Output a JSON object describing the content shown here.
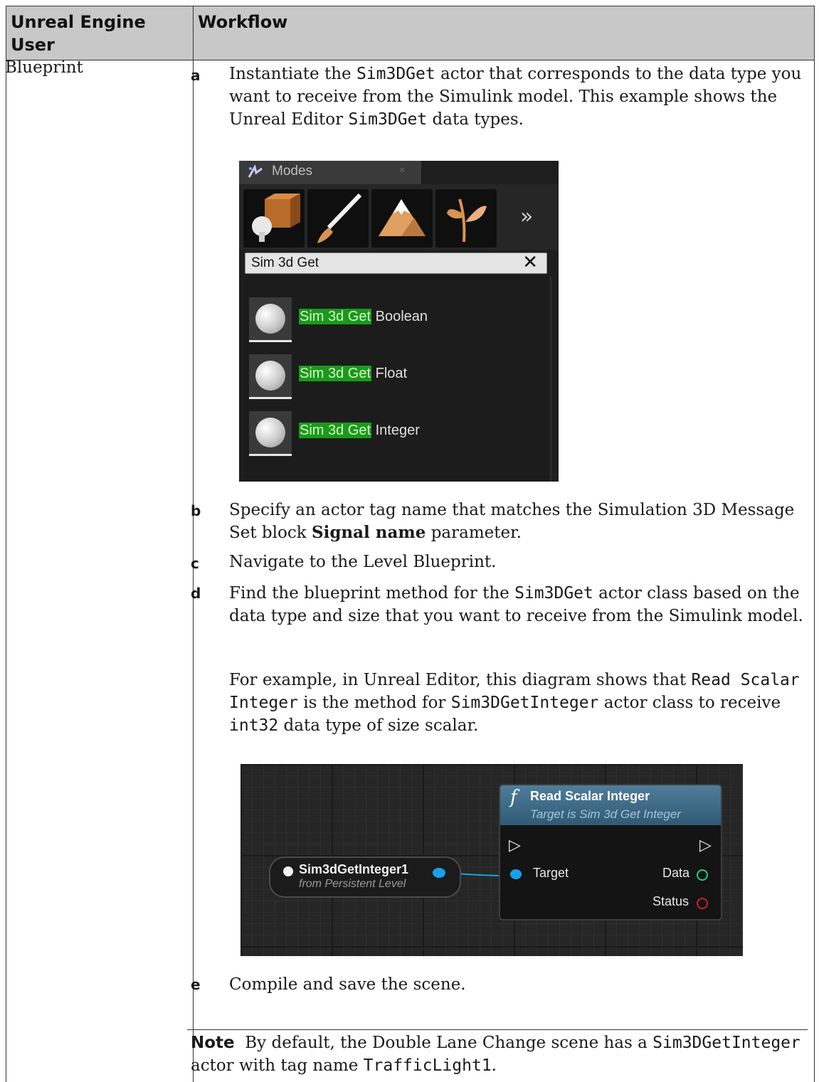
{
  "table": {
    "header": {
      "col1": "Unreal Engine User",
      "col2": "Workflow"
    },
    "row": {
      "user": "Blueprint",
      "steps": [
        {
          "letter": "a",
          "text_parts": [
            "Instantiate the ",
            "Sim3DGet",
            " actor that corresponds to the data type you want to receive from the Simulink model. This example shows the Unreal Editor ",
            "Sim3DGet",
            " data types."
          ]
        },
        {
          "letter": "b",
          "text_parts": [
            "Specify an actor tag name that matches the Simulation 3D Message Set block ",
            "Signal name",
            " parameter."
          ]
        },
        {
          "letter": "c",
          "text": "Navigate to the Level Blueprint."
        },
        {
          "letter": "d",
          "text_parts": [
            "Find the blueprint method for the ",
            "Sim3DGet",
            " actor class based on the data type and size that you want to receive from the Simulink model."
          ],
          "example_parts": [
            "For example, in Unreal Editor, this diagram shows that ",
            "Read Scalar Integer",
            " is the method for ",
            "Sim3DGetInteger",
            " actor class to receive ",
            "int32",
            " data type of size scalar."
          ]
        },
        {
          "letter": "e",
          "text": "Compile and save the scene."
        }
      ],
      "note": {
        "label": "Note",
        "parts": [
          "By default, the Double Lane Change scene has a ",
          "Sim3DGetInteger",
          " actor with tag name ",
          "TrafficLight1",
          "."
        ]
      }
    }
  },
  "modes_panel": {
    "tab_title": "Modes",
    "tab_close": "×",
    "more_glyph": "»",
    "search_value": "Sim 3d Get",
    "clear_glyph": "✕",
    "items": [
      {
        "highlight": "Sim 3d Get",
        "suffix": " Boolean"
      },
      {
        "highlight": "Sim 3d Get",
        "suffix": " Float"
      },
      {
        "highlight": "Sim 3d Get",
        "suffix": " Integer"
      }
    ]
  },
  "blueprint_graph": {
    "var_node": {
      "name": "Sim3dGetInteger1",
      "sub": "from Persistent Level"
    },
    "func_node": {
      "icon": "f",
      "title": "Read Scalar Integer",
      "subtitle": "Target is Sim 3d Get Integer",
      "exec_in": "▷",
      "exec_out": "▷",
      "input_pin": "Target",
      "outputs": [
        "Data",
        "Status"
      ]
    },
    "colors": {
      "object_pin": "#1aa0ea",
      "data_pin": "#22cc88",
      "status_pin": "#cc2222",
      "header": "#3b6a88"
    }
  }
}
